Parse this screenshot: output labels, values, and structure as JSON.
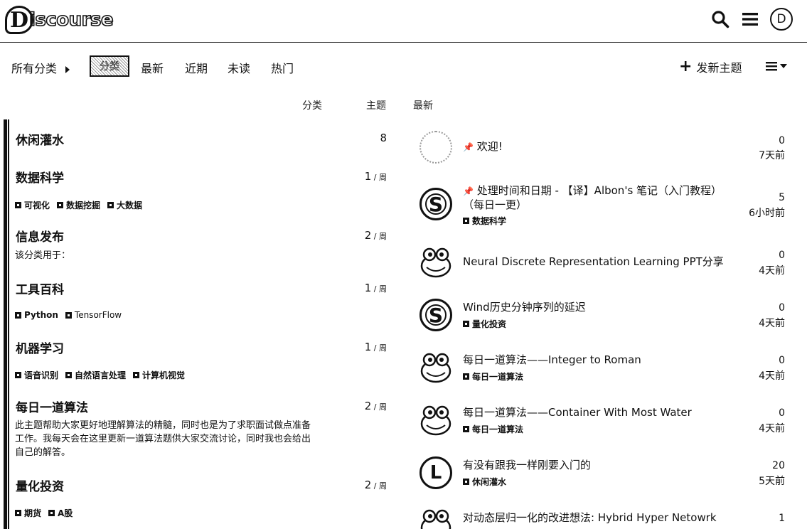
{
  "header": {
    "logo_text": "iscourse",
    "logo_letter": "D",
    "avatar_letter": "D"
  },
  "nav": {
    "all_categories": "所有分类",
    "active": "分类",
    "latest": "最新",
    "recent": "近期",
    "unread": "未读",
    "top": "热门",
    "new_topic": "发新主题"
  },
  "columns": {
    "category": "分类",
    "topics": "主题",
    "latest": "最新"
  },
  "categories": [
    {
      "name": "休闲灌水",
      "count": "8",
      "per": ""
    },
    {
      "name": "数据科学",
      "count": "1",
      "per": " / 周",
      "subs": [
        "可视化",
        "数据挖掘",
        "大数据"
      ]
    },
    {
      "name": "信息发布",
      "count": "2",
      "per": " / 周",
      "desc": "该分类用于："
    },
    {
      "name": "工具百科",
      "count": "1",
      "per": " / 周",
      "subs": [
        "Python",
        "TensorFlow"
      ]
    },
    {
      "name": "机器学习",
      "count": "1",
      "per": " / 周",
      "subs": [
        "语音识别",
        "自然语言处理",
        "计算机视觉"
      ]
    },
    {
      "name": "每日一道算法",
      "count": "2",
      "per": " / 周",
      "desc": "此主题帮助大家更好地理解算法的精髓，同时也是为了求职面试做点准备工作。我每天会在这里更新一道算法题供大家交流讨论，同时我也会给出自己的解答。"
    },
    {
      "name": "量化投资",
      "count": "2",
      "per": " / 周",
      "subs": [
        "期货",
        "A股"
      ]
    }
  ],
  "topics": [
    {
      "title": "欢迎!",
      "pinned": true,
      "category": "",
      "posts": "0",
      "age": "7天前"
    },
    {
      "title": "处理时间和日期 - 【译】Albon's 笔记（入门教程）（每日一更）",
      "pinned": true,
      "category": "数据科学",
      "posts": "5",
      "age": "6小时前"
    },
    {
      "title": "Neural Discrete Representation Learning PPT分享",
      "category": "",
      "posts": "0",
      "age": "4天前"
    },
    {
      "title": "Wind历史分钟序列的延迟",
      "category": "量化投资",
      "posts": "0",
      "age": "4天前"
    },
    {
      "title": "每日一道算法——Integer to Roman",
      "category": "每日一道算法",
      "posts": "0",
      "age": "4天前"
    },
    {
      "title": "每日一道算法——Container With Most Water",
      "category": "每日一道算法",
      "posts": "0",
      "age": "4天前"
    },
    {
      "title": "有没有跟我一样刚要入门的",
      "category": "休闲灌水",
      "posts": "20",
      "age": "5天前"
    },
    {
      "title": "对动态层归一化的改进想法: Hybrid Hyper Netowrk",
      "category": "",
      "posts": "1",
      "age": ""
    }
  ],
  "avatars": {
    "s": "S",
    "l": "L"
  },
  "pin_glyph": "📌"
}
